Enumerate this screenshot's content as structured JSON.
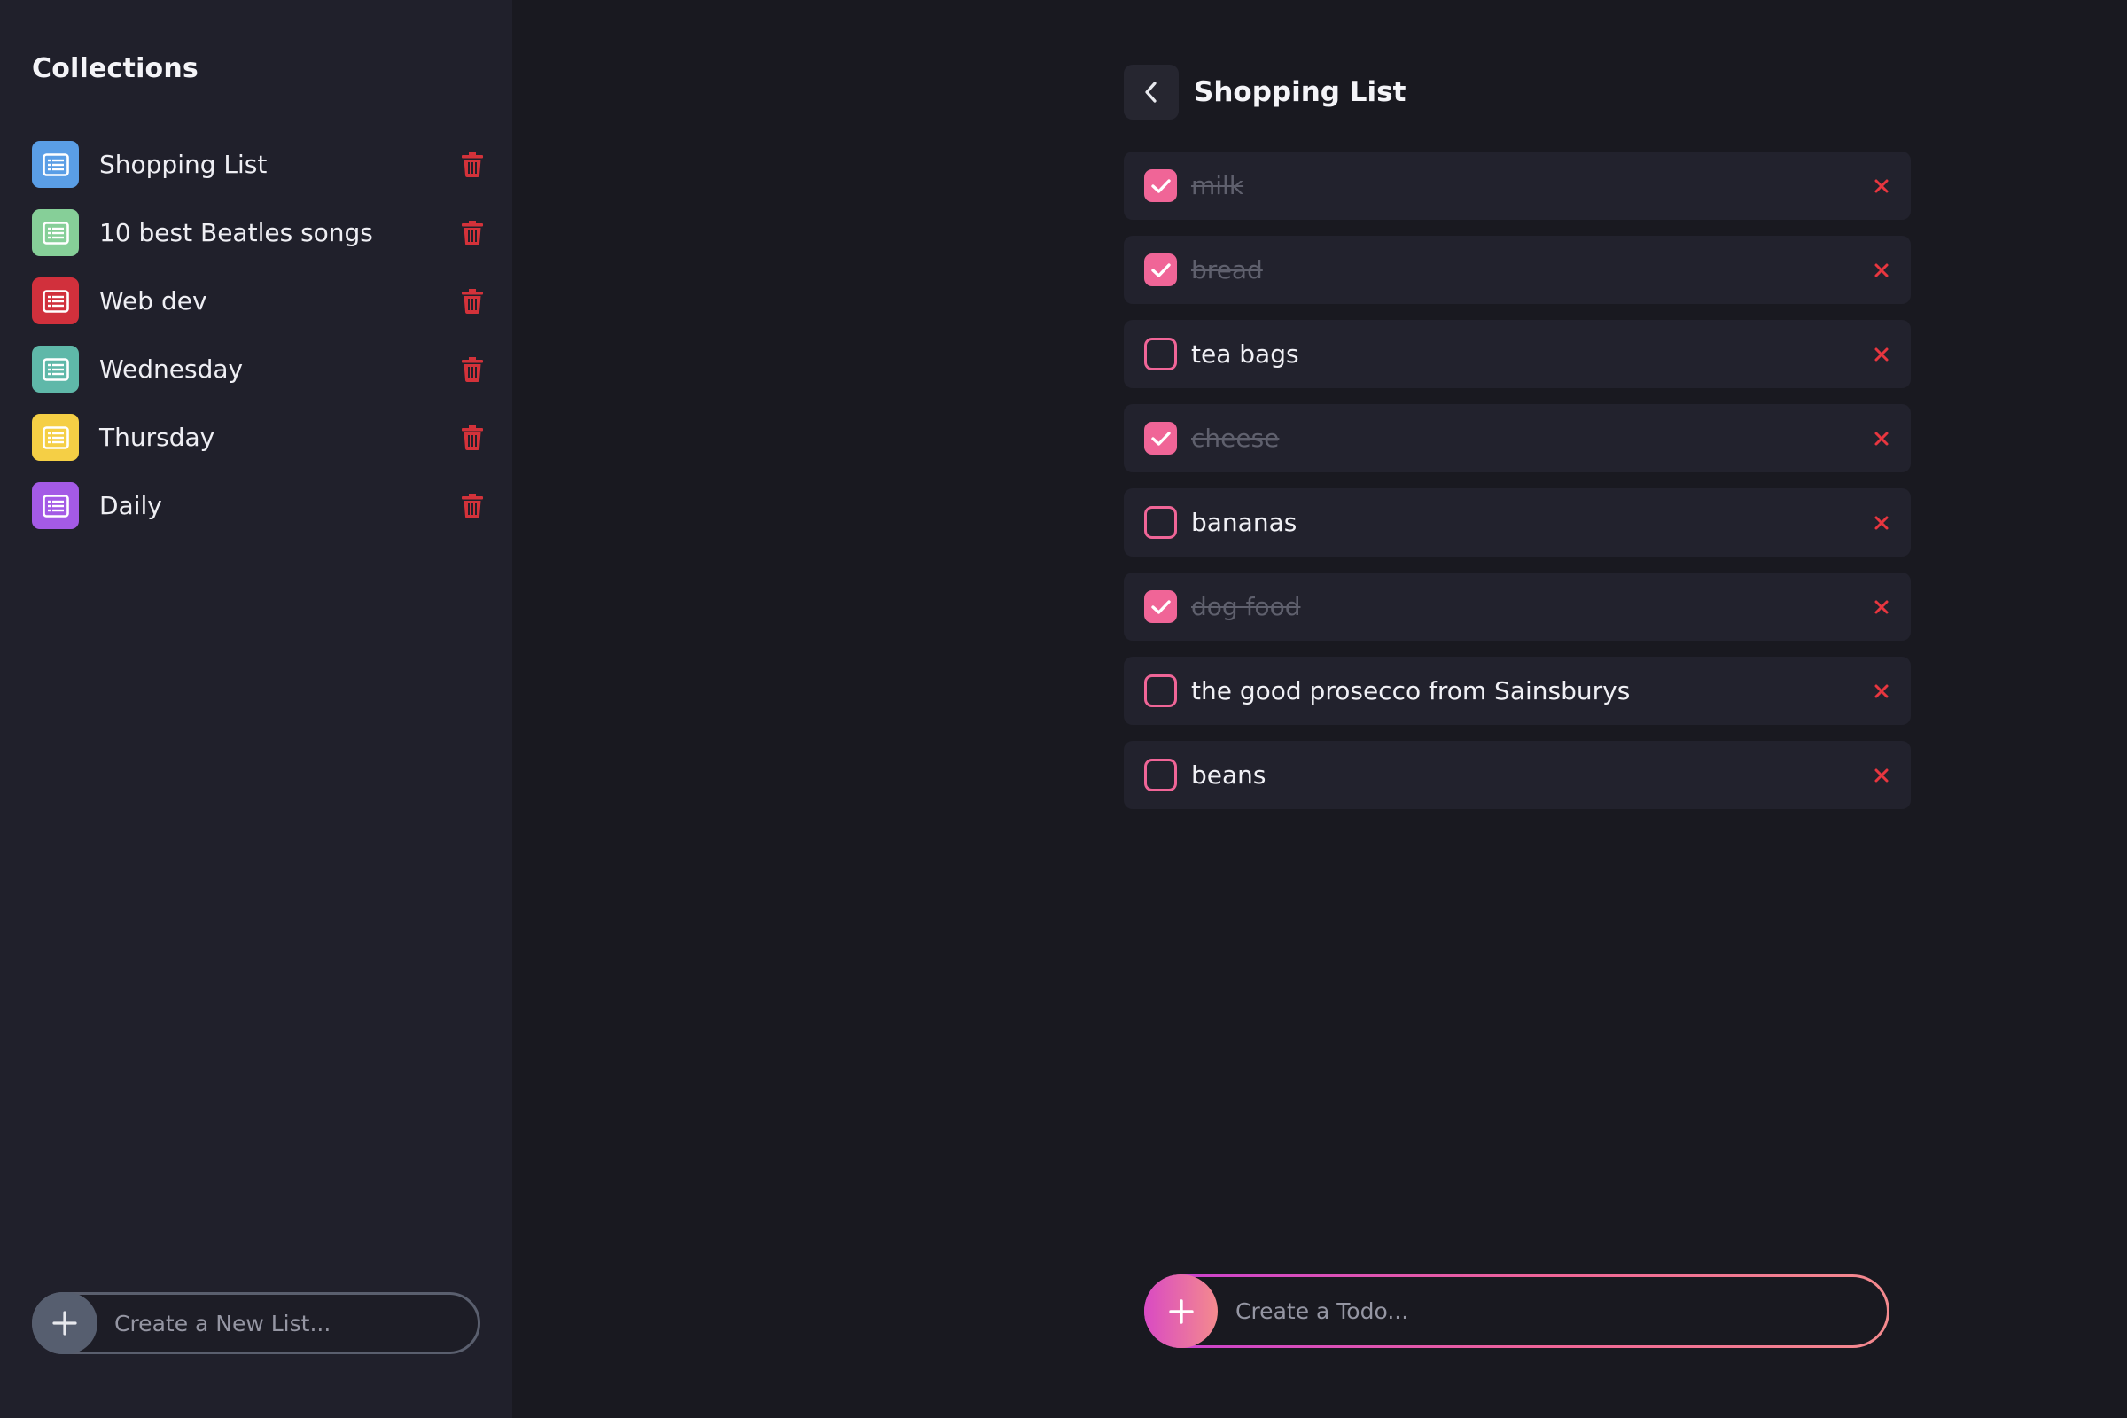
{
  "sidebar": {
    "title": "Collections",
    "collections": [
      {
        "label": "Shopping List",
        "color": "#5a9ee6",
        "icon": "list-icon"
      },
      {
        "label": "10 best Beatles songs",
        "color": "#86cf98",
        "icon": "list-icon"
      },
      {
        "label": "Web dev",
        "color": "#d1303c",
        "icon": "list-icon"
      },
      {
        "label": "Wednesday",
        "color": "#5fb8a9",
        "icon": "list-icon"
      },
      {
        "label": "Thursday",
        "color": "#f5cf45",
        "icon": "list-icon"
      },
      {
        "label": "Daily",
        "color": "#a45ae6",
        "icon": "list-icon"
      }
    ],
    "delete_icon": "trash-icon",
    "delete_color": "#d3323a",
    "new_list_placeholder": "Create a New List..."
  },
  "main": {
    "title": "Shopping List",
    "back_icon": "chevron-left-icon",
    "accent_color": "#f06597",
    "delete_color": "#e8363f",
    "todos": [
      {
        "text": "milk",
        "done": true
      },
      {
        "text": "bread",
        "done": true
      },
      {
        "text": "tea bags",
        "done": false
      },
      {
        "text": "cheese",
        "done": true
      },
      {
        "text": "bananas",
        "done": false
      },
      {
        "text": "dog food",
        "done": true
      },
      {
        "text": "the good prosecco from Sainsburys",
        "done": false
      },
      {
        "text": "beans",
        "done": false
      }
    ],
    "new_todo_placeholder": "Create a Todo..."
  }
}
